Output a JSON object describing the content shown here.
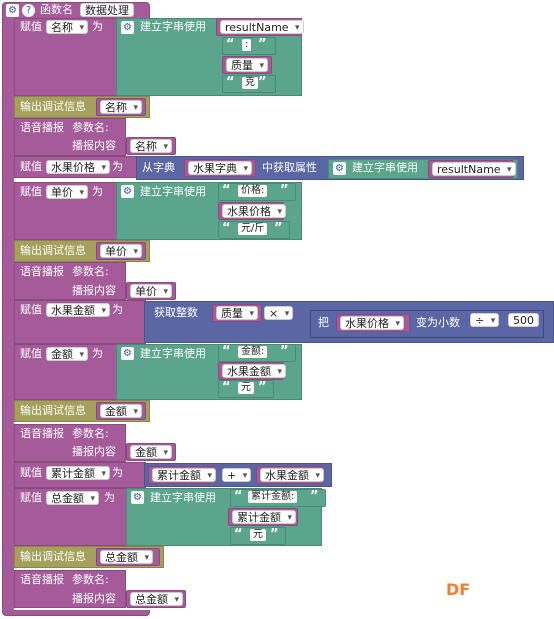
{
  "header": {
    "gear": "⚙",
    "help": "?",
    "label": "函数名",
    "name": "数据处理"
  },
  "kw": {
    "assign": "赋值",
    "as": "为",
    "build_str": "建立字串使用",
    "debug_out": "输出调试信息",
    "voice": "语音播报",
    "param": "参数名:",
    "content": "播报内容",
    "from_dict": "从字典",
    "get_attr": "中获取属性",
    "get_int": "获取整数",
    "to_decimal": "变为小数",
    "ba": "把"
  },
  "vars": {
    "mingcheng": "名称",
    "shuiguojiage": "水果价格",
    "danjia": "单价",
    "shuiguojine": "水果金额",
    "jine": "金额",
    "leijijine": "累计金额",
    "zongjine": "总金额",
    "resultName": "resultName",
    "zhiliang": "质量",
    "shuiguozidian": "水果字典"
  },
  "strings": {
    "colon": ":",
    "ke": "克",
    "jiage": "价格:",
    "yuanjin": "元/斤",
    "jine": "金额:",
    "yuan": "元",
    "leiji": "累计金额:"
  },
  "ops": {
    "times": "×",
    "divide": "÷",
    "plus": "+"
  },
  "numbers": {
    "n500": "500"
  },
  "quote_open": "“",
  "quote_close": "”",
  "watermark": "DF"
}
